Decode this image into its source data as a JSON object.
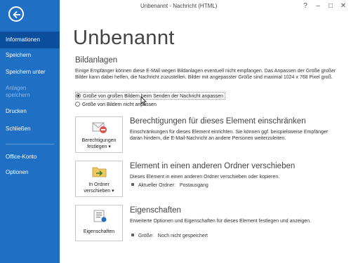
{
  "window": {
    "title": "Unbenannt - Nachricht (HTML)",
    "help": "?",
    "minimize": "–",
    "restore": "□",
    "close": "✕"
  },
  "sidebar": {
    "items": [
      {
        "label": "Informationen",
        "state": "active"
      },
      {
        "label": "Speichern",
        "state": "normal"
      },
      {
        "label": "Speichern unter",
        "state": "normal"
      },
      {
        "label": "Anlagen speichern",
        "state": "disabled"
      },
      {
        "label": "Drucken",
        "state": "normal"
      },
      {
        "label": "Schließen",
        "state": "normal"
      },
      {
        "label": "Office-Konto",
        "state": "normal"
      },
      {
        "label": "Optionen",
        "state": "normal"
      }
    ]
  },
  "main": {
    "title": "Unbenannt",
    "attachments": {
      "heading": "Bildanlagen",
      "description": "Einige Empfänger können diese E-Mail wegen Bildanlagen eventuell nicht empfangen. Das Anpassen der Größe großer Bilder kann dabei helfen, die Nachricht zuzustellen. Bilder mit angepasster Größe sind maximal 1024 x 768 Pixel groß.",
      "options": [
        {
          "label": "Größe von großen Bildern beim Senden der Nachricht anpassen",
          "checked": true
        },
        {
          "label": "Größe von Bildern nicht anpassen",
          "checked": false
        }
      ]
    },
    "sections": [
      {
        "button_label": "Berechtigungen festlegen ▾",
        "button_line1": "Berechtigungen",
        "button_line2": "festlegen ▾",
        "icon": "envelope-restrict-icon",
        "heading": "Berechtigungen für dieses Element einschränken",
        "description": "Einschränkungen für dieses Element einrichten. Sie können ggf. beispielsweise Empfänger daran hindern, die E-Mail-Nachricht an andere Personen weiterzuleiten."
      },
      {
        "button_line1": "In Ordner",
        "button_line2": "verschieben ▾",
        "icon": "folder-move-icon",
        "heading": "Element in einen anderen Ordner verschieben",
        "description": "Dieses Element in einen anderen Ordner verschieben oder kopieren.",
        "detail_label": "Aktueller Ordner:",
        "detail_value": "Postausgang"
      },
      {
        "button_line1": "Eigenschaften",
        "icon": "properties-icon",
        "heading": "Eigenschaften",
        "description": "Erweiterte Optionen und Eigenschaften für dieses Element festlegen und anzeigen.",
        "detail_label": "Größe:",
        "detail_value": "Noch nicht gespeichert"
      }
    ]
  },
  "colors": {
    "sidebar": "#1f6fc5",
    "sidebar_active": "#0b4f9c",
    "accent_red": "#d9534f"
  }
}
